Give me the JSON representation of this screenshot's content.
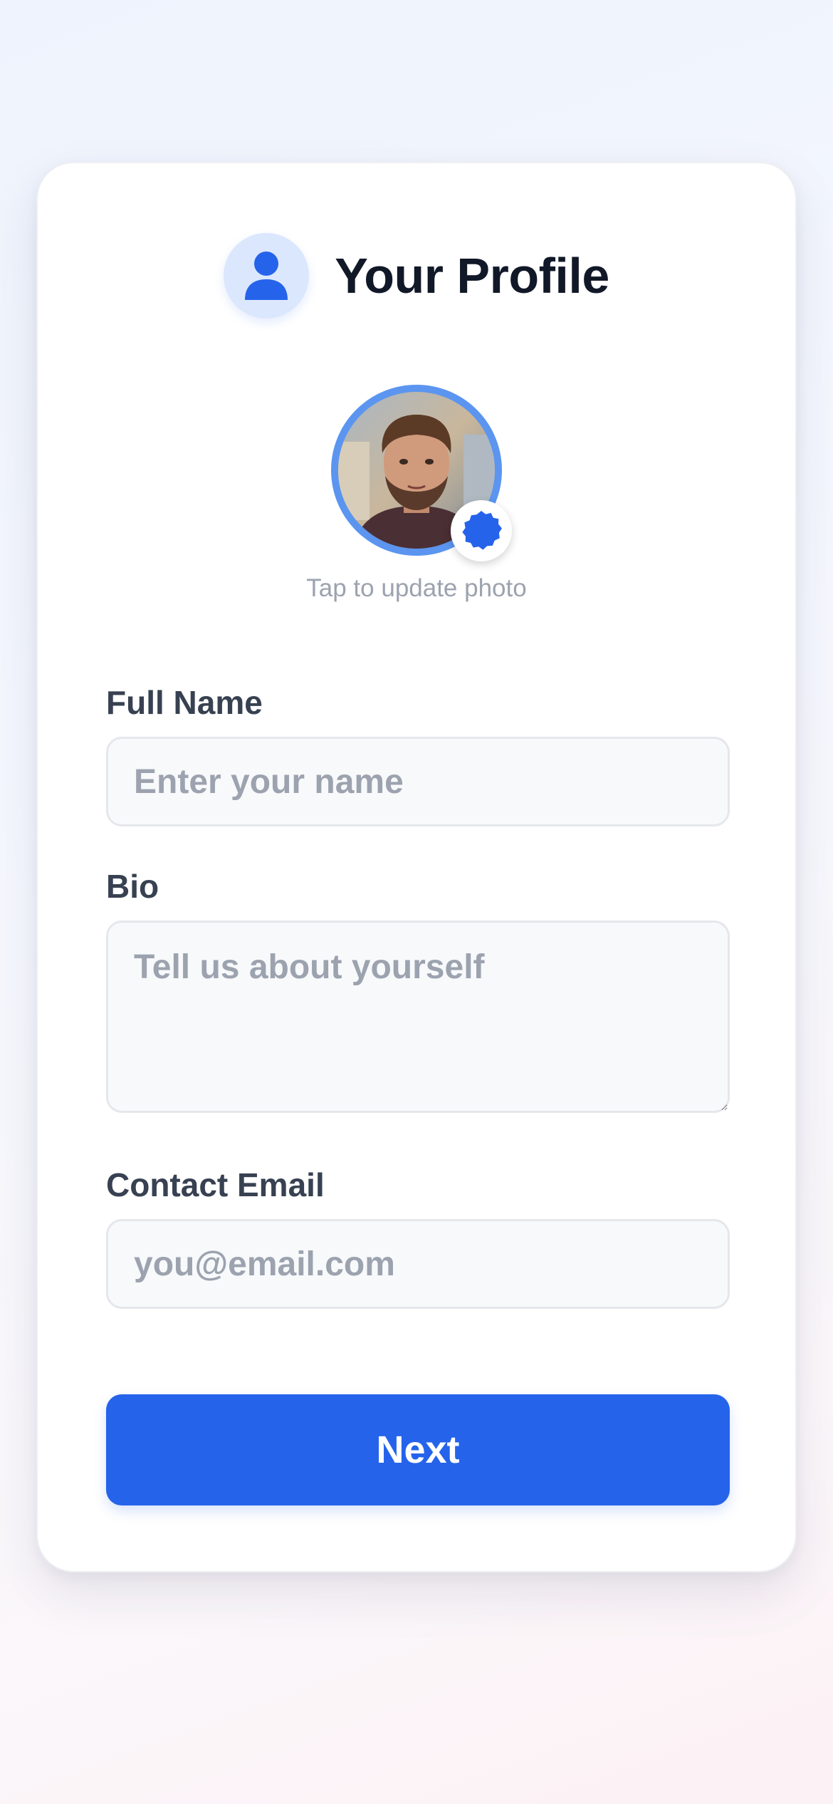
{
  "header": {
    "title": "Your Profile",
    "icon": "user-icon"
  },
  "avatar": {
    "icon": "edit-badge-icon",
    "caption": "Tap to update photo"
  },
  "form": {
    "full_name": {
      "label": "Full Name",
      "placeholder": "Enter your name",
      "value": ""
    },
    "bio": {
      "label": "Bio",
      "placeholder": "Tell us about yourself",
      "value": ""
    },
    "email": {
      "label": "Contact Email",
      "placeholder": "you@email.com",
      "value": ""
    }
  },
  "actions": {
    "next_label": "Next"
  },
  "colors": {
    "accent": "#2563eb",
    "avatar_ring": "#5b95f0",
    "header_icon_bg": "#dbe7fd",
    "title": "#111827",
    "label": "#374151",
    "placeholder": "#9ca3af"
  }
}
